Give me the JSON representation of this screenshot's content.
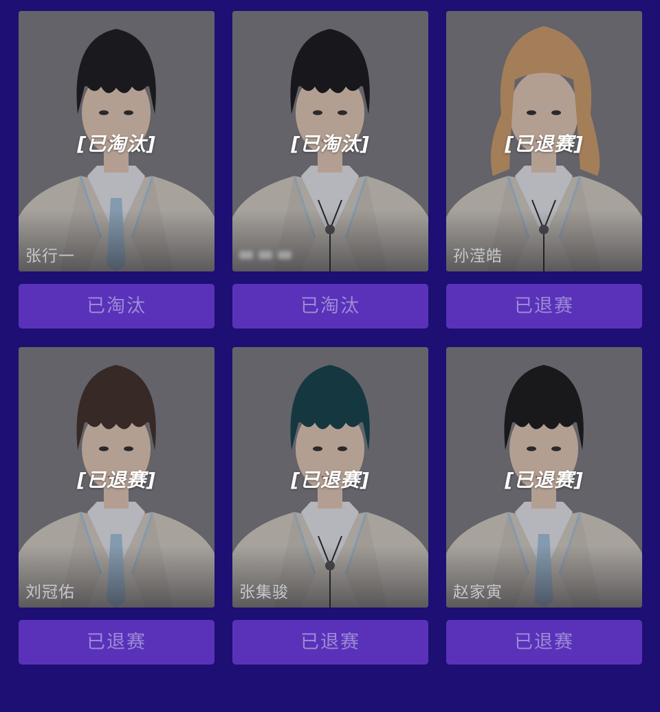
{
  "contestants": [
    {
      "name": "张行一",
      "status_overlay": "[已淘汰]",
      "status_button": "已淘汰",
      "hair_color": "#161618",
      "suit": "tie",
      "name_visible": true
    },
    {
      "name": "",
      "status_overlay": "[已淘汰]",
      "status_button": "已淘汰",
      "hair_color": "#131315",
      "suit": "bolo",
      "name_visible": false
    },
    {
      "name": "孙滢皓",
      "status_overlay": "[已退赛]",
      "status_button": "已退赛",
      "hair_color": "#d3a06a",
      "suit": "bolo",
      "name_visible": true
    },
    {
      "name": "刘冠佑",
      "status_overlay": "[已退赛]",
      "status_button": "已退赛",
      "hair_color": "#3e2a22",
      "suit": "tie",
      "name_visible": true
    },
    {
      "name": "张集骏",
      "status_overlay": "[已退赛]",
      "status_button": "已退赛",
      "hair_color": "#0f3e47",
      "suit": "bolo",
      "name_visible": true
    },
    {
      "name": "赵家寅",
      "status_overlay": "[已退赛]",
      "status_button": "已退赛",
      "hair_color": "#141416",
      "suit": "tie",
      "name_visible": true
    }
  ],
  "colors": {
    "background": "#1d0f73",
    "button": "#5a32b9",
    "button_text": "#9c8bd6",
    "photo_bg": "#707076",
    "suit": "#d8d2c6",
    "shirt": "#eceef2",
    "tie": "#a8c6e0",
    "skin": "#e9cdb9"
  }
}
